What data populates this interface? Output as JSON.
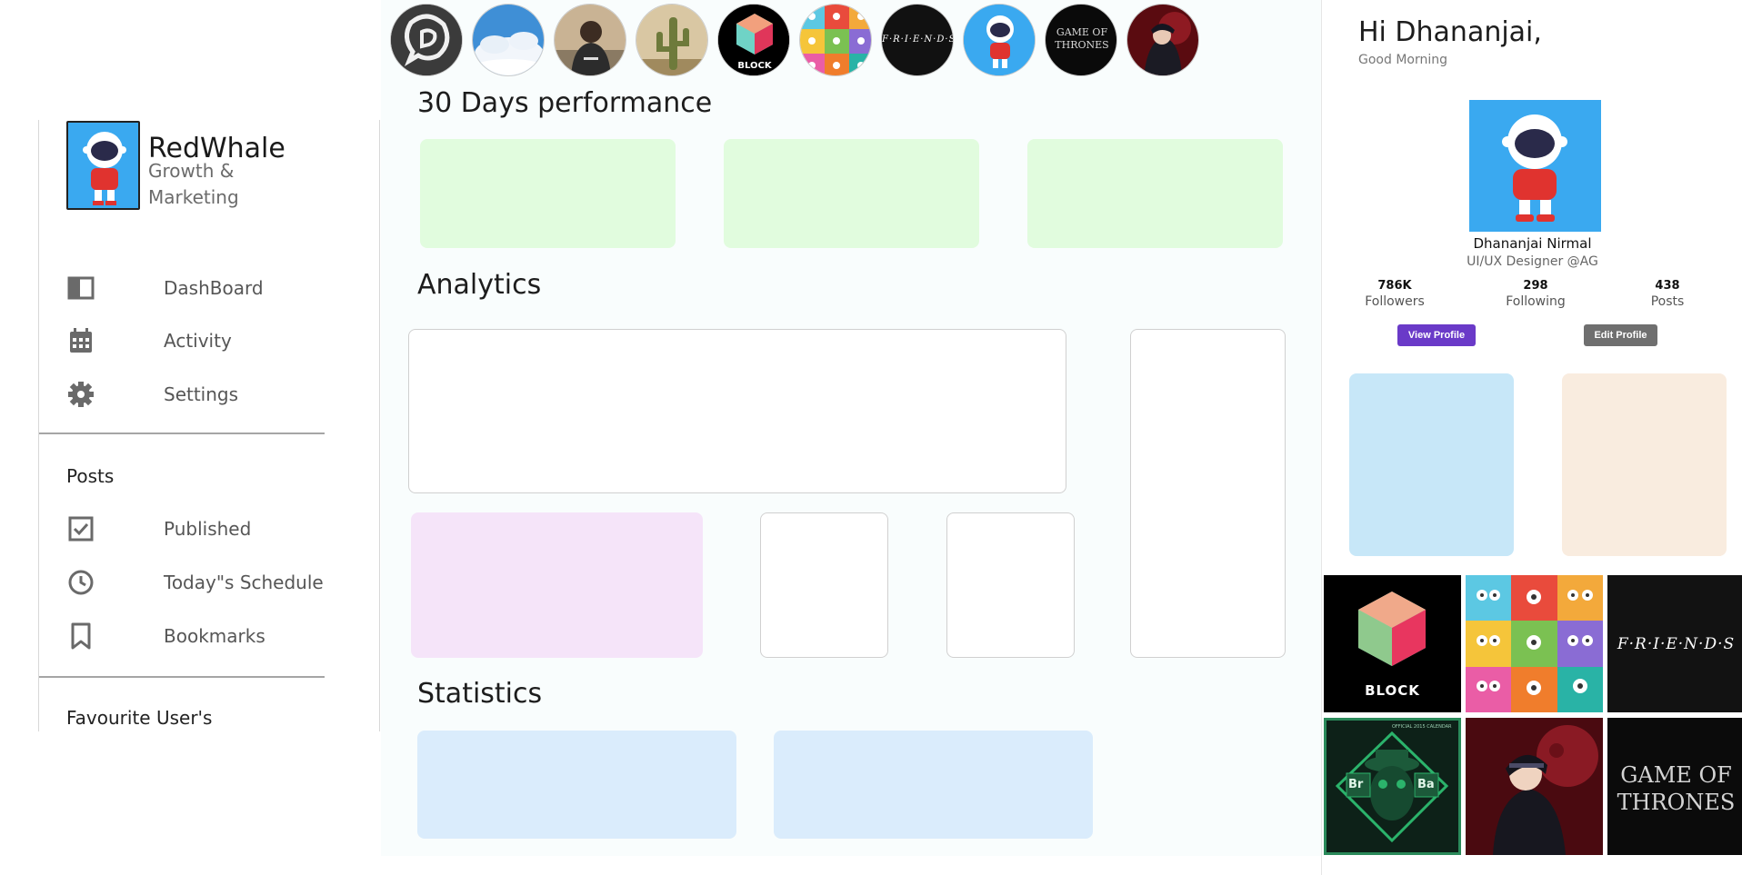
{
  "brand": {
    "name": "RedWhale",
    "tagline": "Growth & Marketing"
  },
  "nav": [
    {
      "label": "DashBoard",
      "icon": "dashboard-icon"
    },
    {
      "label": "Activity",
      "icon": "calendar-icon"
    },
    {
      "label": "Settings",
      "icon": "gear-icon"
    }
  ],
  "posts_section": {
    "title": "Posts",
    "items": [
      {
        "label": "Published",
        "icon": "checkbox-icon"
      },
      {
        "label": "Today\"s Schedule",
        "icon": "clock-icon"
      },
      {
        "label": "Bookmarks",
        "icon": "bookmark-icon"
      }
    ]
  },
  "favourites_title": "Favourite User's",
  "stories": [
    {
      "name": "chat-logo"
    },
    {
      "name": "sky-clouds"
    },
    {
      "name": "hoodie-person"
    },
    {
      "name": "cactus-desert"
    },
    {
      "name": "block-logo",
      "text": "BLOCK"
    },
    {
      "name": "monsters-grid"
    },
    {
      "name": "friends-logo",
      "text": "F·R·I·E·N·D·S"
    },
    {
      "name": "astronaut"
    },
    {
      "name": "got-logo",
      "text": "GAME OF THRONES"
    },
    {
      "name": "ninja"
    }
  ],
  "sections": {
    "performance": "30 Days performance",
    "analytics": "Analytics",
    "statistics": "Statistics"
  },
  "colors": {
    "green_card": "#e1fcde",
    "purple_card": "#f5e4f9",
    "blue_card": "#daecfc",
    "sky_card": "#c7e7f8",
    "peach_card": "#f9ecdf",
    "view_btn": "#6a3ac8",
    "edit_btn": "#6f6f6f"
  },
  "profile": {
    "greeting": "Hi Dhananjai,",
    "subgreeting": "Good Morning",
    "name": "Dhananjai Nirmal",
    "role": "UI/UX Designer @AG",
    "stats": [
      {
        "value": "786K",
        "label": "Followers"
      },
      {
        "value": "298",
        "label": "Following"
      },
      {
        "value": "438",
        "label": "Posts"
      }
    ],
    "view_label": "View Profile",
    "edit_label": "Edit Profile"
  },
  "gallery": [
    {
      "name": "block",
      "text": "BLOCK"
    },
    {
      "name": "monsters"
    },
    {
      "name": "friends",
      "text": "F·R·I·E·N·D·S"
    },
    {
      "name": "breaking-bad",
      "text_left": "Br",
      "text_right": "Ba",
      "caption": "OFFICIAL 2015 CALENDAR"
    },
    {
      "name": "itachi"
    },
    {
      "name": "got",
      "text": "GAME OF THRONES"
    }
  ]
}
